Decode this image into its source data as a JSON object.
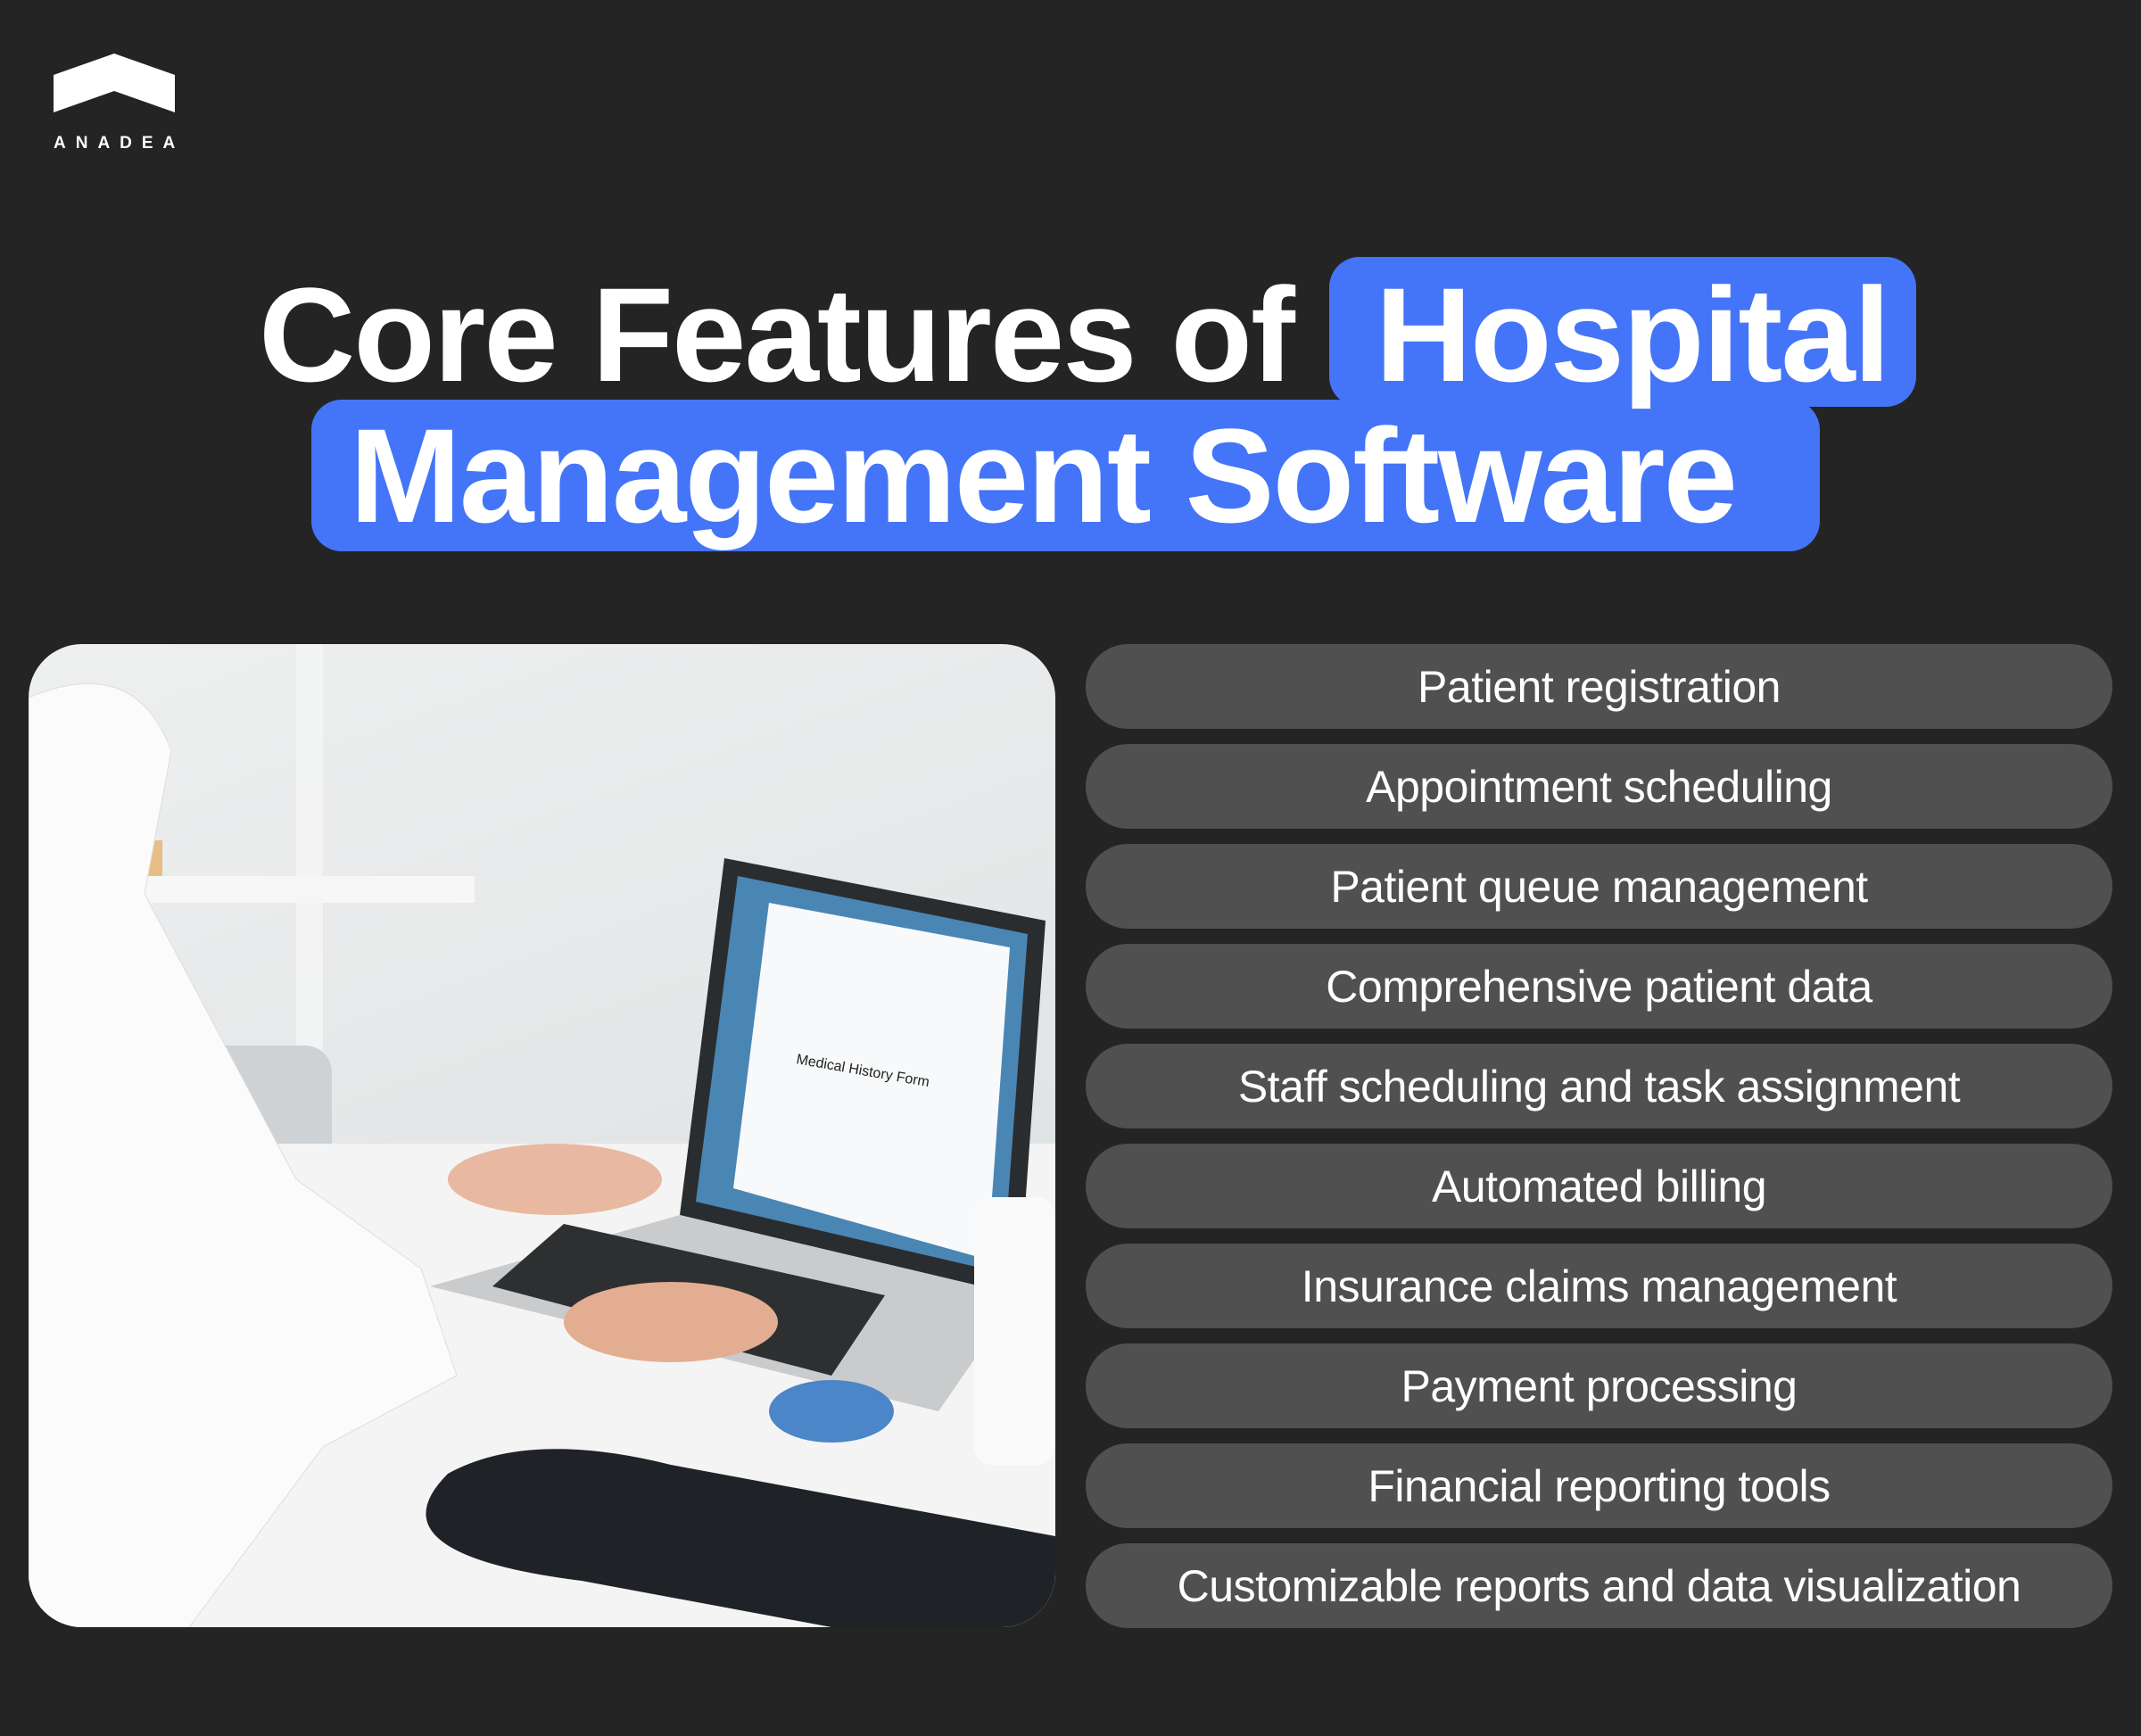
{
  "brand": {
    "name": "ANADEA"
  },
  "title": {
    "line1_plain": "Core Features of",
    "line1_highlight": "Hospital",
    "line2_highlight": "Management Software"
  },
  "colors": {
    "background": "#242424",
    "highlight": "#4475f8",
    "pill": "#505050",
    "text": "#ffffff"
  },
  "photo": {
    "form_title": "Medical History Form"
  },
  "features": [
    "Patient registration",
    "Appointment scheduling",
    "Patient queue management",
    "Comprehensive patient data",
    "Staff scheduling and task assignment",
    "Automated billing",
    "Insurance claims management",
    "Payment processing",
    "Financial reporting tools",
    "Customizable reports and data visualization"
  ]
}
